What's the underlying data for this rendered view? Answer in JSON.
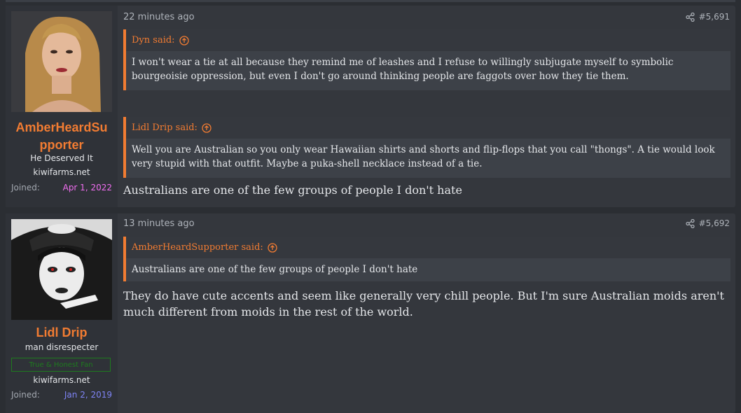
{
  "colors": {
    "accent": "#f27c32",
    "joined_date_1": "#f06ef0",
    "joined_date_2": "#7f84f5",
    "banner_green": "#1e7b1e"
  },
  "posts": [
    {
      "user": {
        "name_line1": "AmberHeardSu",
        "name_line2": "pporter",
        "title": "He Deserved It",
        "site": "kiwifarms.net",
        "joined_label": "Joined:",
        "joined_date": "Apr 1, 2022"
      },
      "time": "22 minutes ago",
      "post_number": "#5,691",
      "quotes": [
        {
          "author": "Dyn said:",
          "text": "I won't wear a tie at all because they remind me of leashes and I refuse to willingly subjugate myself to symbolic bourgeoisie oppression, but even I don't go around thinking people are faggots over how they tie them."
        },
        {
          "author": "Lidl Drip said:",
          "text": "Well you are Australian so you only wear Hawaiian shirts and shorts and flip-flops that you call \"thongs\". A tie would look very stupid with that outfit. Maybe a puka-shell necklace instead of a tie."
        }
      ],
      "body": "Australians are one of the few groups of people I don't hate"
    },
    {
      "user": {
        "name": "Lidl Drip",
        "title": "man disrespecter",
        "banner": "True & Honest Fan",
        "site": "kiwifarms.net",
        "joined_label": "Joined:",
        "joined_date": "Jan 2, 2019"
      },
      "time": "13 minutes ago",
      "post_number": "#5,692",
      "quotes": [
        {
          "author": "AmberHeardSupporter said:",
          "text": "Australians are one of the few groups of people I don't hate"
        }
      ],
      "body": "They do have cute accents and seem like generally very chill people. But I'm sure Australian moids aren't much different from moids in the rest of the world."
    }
  ]
}
